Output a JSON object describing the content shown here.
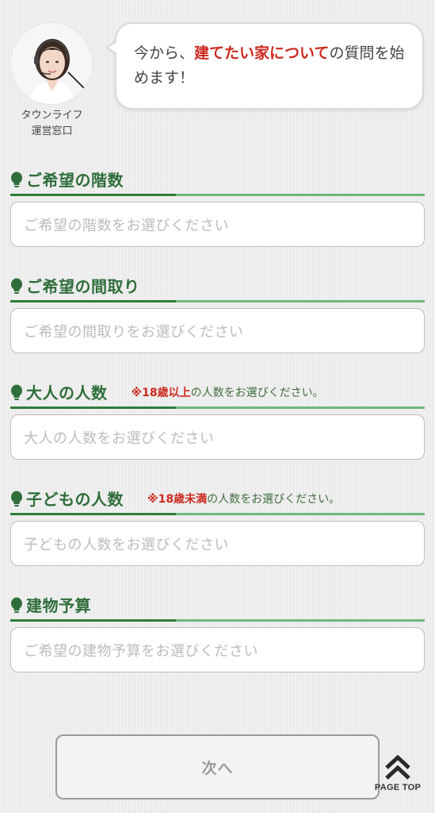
{
  "operator": {
    "name_line1": "タウンライフ",
    "name_line2": "運営窓口"
  },
  "bubble": {
    "text_before": "今から、",
    "text_highlight": "建てたい家について",
    "text_after": "の質問を始めます！"
  },
  "sections": [
    {
      "title": "ご希望の階数",
      "placeholder": "ご希望の階数をお選びください"
    },
    {
      "title": "ご希望の間取り",
      "placeholder": "ご希望の間取りをお選びください"
    },
    {
      "title": "大人の人数",
      "note_red": "※18歳以上",
      "note_rest": "の人数をお選びください。",
      "placeholder": "大人の人数をお選びください"
    },
    {
      "title": "子どもの人数",
      "note_red": "※18歳未満",
      "note_rest": "の人数をお選びください。",
      "placeholder": "子どもの人数をお選びください"
    },
    {
      "title": "建物予算",
      "placeholder": "ご希望の建物予算をお選びください"
    }
  ],
  "footer": {
    "next_label": "次へ",
    "page_top_label": "PAGE TOP"
  },
  "colors": {
    "accent_green": "#2f6e3a",
    "highlight_red": "#cc2a1f"
  },
  "icons": {
    "bulb": "lightbulb-icon",
    "page_top": "double-chevron-up-icon"
  }
}
